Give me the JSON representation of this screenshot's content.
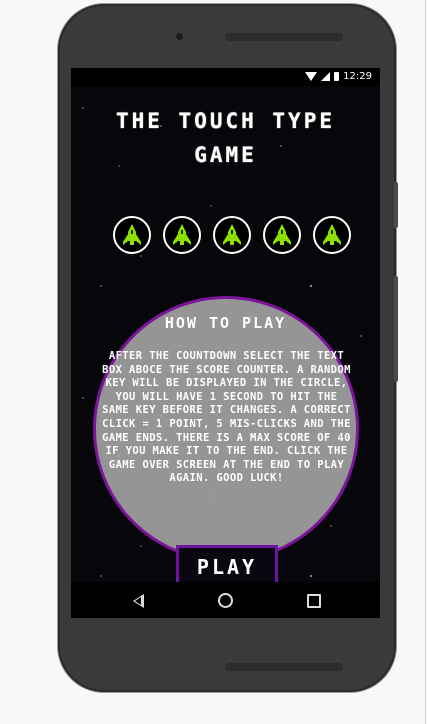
{
  "status_bar": {
    "time": "12:29"
  },
  "game": {
    "title_line1": "THE TOUCH TYPE",
    "title_line2": "GAME",
    "lives": 5,
    "ship_color": "#8ee000",
    "how_to_play": {
      "heading": "HOW TO PLAY",
      "text": "AFTER THE COUNTDOWN SELECT THE TEXT BOX ABOCE THE SCORE COUNTER. A RANDOM KEY WILL BE DISPLAYED IN THE CIRCLE, YOU WILL HAVE 1 SECOND TO HIT THE SAME KEY BEFORE IT CHANGES. A CORRECT CLICK = 1 POINT, 5 MIS-CLICKS AND THE GAME ENDS. THERE IS A MAX SCORE OF 40 IF YOU MAKE IT TO THE END. CLICK THE GAME OVER SCREEN AT THE END TO PLAY AGAIN. GOOD LUCK!"
    },
    "play_label": "PLAY"
  },
  "icons": {
    "ship": "spaceship-icon",
    "wifi": "wifi-icon",
    "signal": "cell-signal-icon",
    "battery": "battery-icon",
    "back": "back-icon",
    "home": "home-icon",
    "recent": "recent-apps-icon"
  },
  "colors": {
    "circle_border": "#7d159c",
    "play_border": "#6a16a0"
  }
}
